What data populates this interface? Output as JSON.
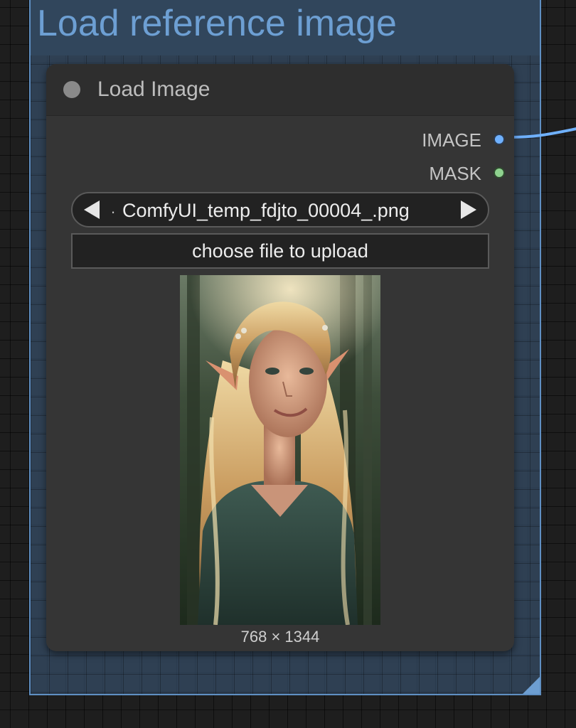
{
  "group": {
    "title": "Load reference image"
  },
  "node": {
    "title": "Load Image",
    "outputs": [
      {
        "label": "IMAGE",
        "color": "#6fb1ff"
      },
      {
        "label": "MASK",
        "color": "#8fd28f"
      }
    ],
    "image_combo": {
      "prefix": ".",
      "value": "ComfyUI_temp_fdjto_00004_.png"
    },
    "upload_label": "choose file to upload",
    "preview_dimensions": "768 × 1344"
  },
  "icons": {
    "combo_prev": "triangle-left-icon",
    "combo_next": "triangle-right-icon",
    "node_status": "circle-dot-icon"
  },
  "colors": {
    "group_title": "#6d9fd3",
    "group_border": "#5f8fc2",
    "node_bg": "#353535",
    "link": "#6fb1ff"
  }
}
